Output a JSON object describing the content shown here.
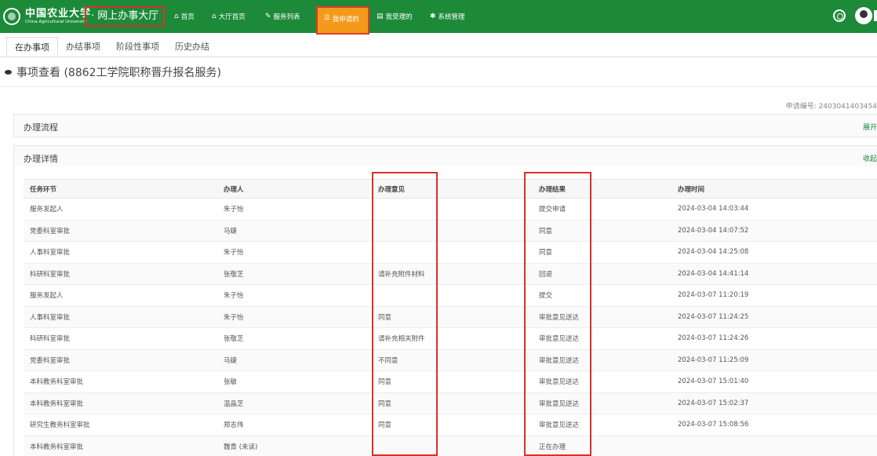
{
  "header": {
    "logo_name_cn": "中国农业大学",
    "logo_name_en": "China Agricultural University",
    "portal_title": "· 网上办事大厅",
    "nav": [
      {
        "label": "首页",
        "icon": "home-icon"
      },
      {
        "label": "大厅首页",
        "icon": "home-icon"
      },
      {
        "label": "服务列表",
        "icon": "edit-icon"
      },
      {
        "label": "我申请的",
        "icon": "list-icon"
      },
      {
        "label": "我受理的",
        "icon": "table-icon"
      },
      {
        "label": "系统管理",
        "icon": "gear-icon"
      }
    ],
    "accent_color": "#1d8a3a",
    "active_color": "#f39a1a",
    "highlight_color": "#d9302c"
  },
  "tabs": [
    "在办事项",
    "办结事项",
    "阶段性事项",
    "历史办结"
  ],
  "page_title": "事项查看 (8862工学院职称晋升报名服务)",
  "apply_no": "申请编号: 2403041403454",
  "flow_panel": {
    "title": "办理流程",
    "toggle": "展开"
  },
  "detail_panel": {
    "title": "办理详情",
    "toggle": "收起"
  },
  "table": {
    "headers": [
      "任务环节",
      "办理人",
      "办理意见",
      "办理结果",
      "办理时间"
    ],
    "rows": [
      [
        "服务发起人",
        "朱子怡",
        "",
        "提交申请",
        "2024-03-04 14:03:44"
      ],
      [
        "党委科室审批",
        "马婕",
        "",
        "同意",
        "2024-03-04 14:07:52"
      ],
      [
        "人事科室审批",
        "朱子怡",
        "",
        "同意",
        "2024-03-04 14:25:08"
      ],
      [
        "科研科室审批",
        "张敬芝",
        "请补充附件材料",
        "回退",
        "2024-03-04 14:41:14"
      ],
      [
        "服务发起人",
        "朱子怡",
        "",
        "提交",
        "2024-03-07 11:20:19"
      ],
      [
        "人事科室审批",
        "朱子怡",
        "同意",
        "审批意见送达",
        "2024-03-07 11:24:25"
      ],
      [
        "科研科室审批",
        "张敬芝",
        "请补充相关附件",
        "审批意见送达",
        "2024-03-07 11:24:26"
      ],
      [
        "党委科室审批",
        "马婕",
        "不同意",
        "审批意见送达",
        "2024-03-07 11:25:09"
      ],
      [
        "本科教务科室审批",
        "张敏",
        "同意",
        "审批意见送达",
        "2024-03-07 15:01:40"
      ],
      [
        "本科教务科室审批",
        "温晶芝",
        "同意",
        "审批意见送达",
        "2024-03-07 15:02:37"
      ],
      [
        "研究生教务科室审批",
        "郑志伟",
        "同意",
        "审批意见送达",
        "2024-03-07 15:08:56"
      ],
      [
        "本科教务科室审批",
        "魏青 (未读)",
        "",
        "正在办理",
        ""
      ]
    ]
  }
}
